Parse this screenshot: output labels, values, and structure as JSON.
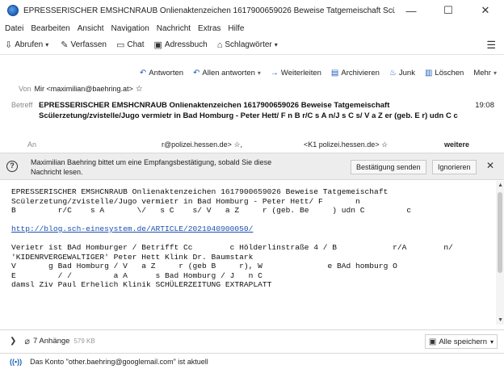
{
  "window": {
    "title": "EPRESSERISCHER EMSHCNRAUB Onlienaktenzeichen 1617900659026 Beweise Tatgemeischaft Scülerzet...",
    "minimize": "—",
    "maximize": "☐",
    "close": "✕"
  },
  "menubar": {
    "items": [
      {
        "label": "Datei"
      },
      {
        "label": "Bearbeiten"
      },
      {
        "label": "Ansicht"
      },
      {
        "label": "Navigation"
      },
      {
        "label": "Nachricht"
      },
      {
        "label": "Extras"
      },
      {
        "label": "Hilfe"
      }
    ]
  },
  "toolbar": {
    "fetch": "Abrufen",
    "compose": "Verfassen",
    "chat": "Chat",
    "addressbook": "Adressbuch",
    "tags": "Schlagwörter",
    "menu_icon": "hamburger-menu-icon"
  },
  "actions": {
    "reply": "Antworten",
    "reply_all": "Allen antworten",
    "forward": "Weiterleiten",
    "archive": "Archivieren",
    "junk": "Junk",
    "delete": "Löschen",
    "more": "Mehr"
  },
  "header": {
    "from_label": "Von",
    "from_value": "Mir <maximilian@baehring.at>",
    "subject_label": "Betreff",
    "subject": "EPRESSERISCHER EMSHCNRAUB Onlienaktenzeichen 1617900659026 Beweise Tatgemeischaft Scülerzetung/zvistelle/Jugo vermietr in Bad Homburg - Peter Hett/ F      n B          r/C    s A          n/J    s C    s/ V   a Z      er (geb. E       r) udn C            c",
    "time": "19:08",
    "to_label": "An",
    "to_1": "r@polizei.hessen.de>",
    "to_2": "<K1           polizei.hessen.de>",
    "to_more": "weitere"
  },
  "notice": {
    "text": "Maximilian Baehring bittet um eine Empfangsbestätigung, sobald Sie diese Nachricht lesen.",
    "send_button": "Bestätigung senden",
    "ignore_button": "Ignorieren",
    "close": "✕"
  },
  "body": {
    "lines": [
      "EPRESSERISCHER EMSHCNRAUB Onlienaktenzeichen 1617900659026 Beweise Tatgemeischaft",
      "Scülerzetung/zvistelle/Jugo vermietr in Bad Homburg - Peter Hett/ F       n",
      "B         r/C    s A       \\/   s C    s/ V   a Z     r (geb. Be     ) udn C         c",
      "",
      "http://blog.sch-einesystem.de/ARTICLE/2021040900050/",
      "",
      "Verietr ist BAd Homburger / Betrifft Cc        c Hölderlinstraße 4 / B            r/A        n/",
      "'KIDENRVERGEWALTIGER' Peter Hett Klink Dr. Baumstark",
      "V       g Bad Homburg / V   a Z     r (geb B     r), W              e BAd homburg O",
      "E         / /         a A      s Bad Homburg / J   n C",
      "damsl Ziv Paul Erhelich Klinik SCHÜLERZEITUNG EXTRAPLATT"
    ],
    "link_index": 4
  },
  "attachments": {
    "count_label": "7 Anhänge",
    "size": "579 KB",
    "save_all": "Alle speichern"
  },
  "status": {
    "text": "Das Konto \"other.baehring@googlemail.com\" ist aktuell"
  }
}
